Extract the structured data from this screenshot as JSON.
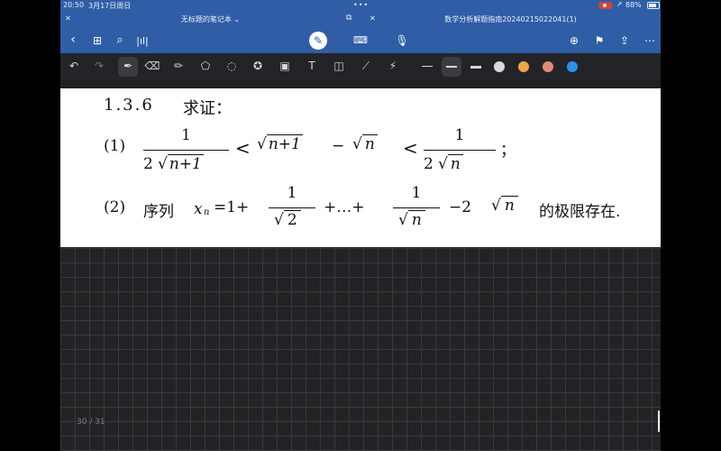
{
  "status_bar": {
    "time": "20:50",
    "date": "3月17日周日",
    "battery": "88%"
  },
  "tabs": {
    "left_title": "无标题的笔记本",
    "right_title": "数学分析解题指南20240215022041(1)"
  },
  "toolbar": {
    "pen_colors": [
      "#d9d9d9",
      "#f0a44a",
      "#e58a7a",
      "#2e8fe8"
    ]
  },
  "problem": {
    "number": "1.3.6",
    "title": "求证：",
    "part1": {
      "label": "(1)",
      "lhs_num": "1",
      "lhs_den_coef": "2",
      "lhs_den_rad": "n+1",
      "lt1": "<",
      "mid_rad1": "n+1",
      "minus": "−",
      "mid_rad2": "n",
      "lt2": "<",
      "rhs_num": "1",
      "rhs_den_coef": "2",
      "rhs_den_rad": "n",
      "end": "；"
    },
    "part2": {
      "label": "(2)",
      "text_seq": "序列",
      "var": "x",
      "sub": "n",
      "eq": "=1+",
      "f1_num": "1",
      "f1_rad": "2",
      "dots": "+…+",
      "f2_num": "1",
      "f2_rad": "n",
      "minus2": "−2",
      "tail_rad": "n",
      "tail_text": "的极限存在."
    }
  },
  "page_indicator": "30 / 31"
}
